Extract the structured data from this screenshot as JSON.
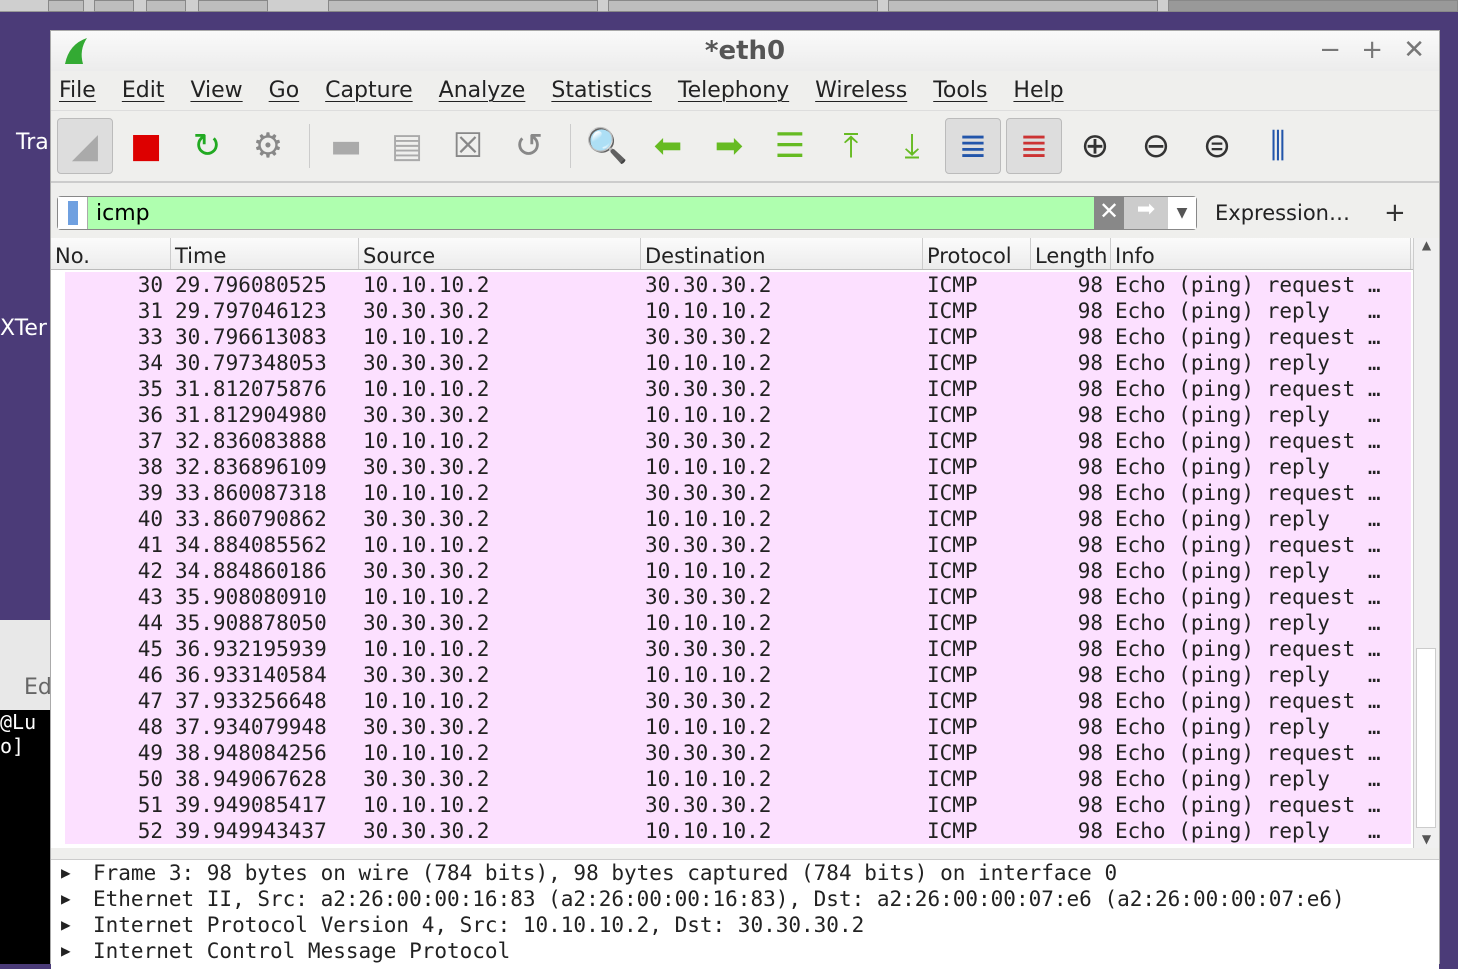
{
  "window": {
    "title": "*eth0",
    "minimize": "−",
    "maximize": "+",
    "close": "✕"
  },
  "desktop": {
    "labels": [
      "Tra",
      "XTer",
      "Ed",
      "@Lu",
      "o]"
    ]
  },
  "menu": [
    "File",
    "Edit",
    "View",
    "Go",
    "Capture",
    "Analyze",
    "Statistics",
    "Telephony",
    "Wireless",
    "Tools",
    "Help"
  ],
  "toolbar": [
    {
      "icon": "shark-fin-start-icon",
      "glyph": "◢",
      "color": "#aaaaaa",
      "on": true
    },
    {
      "icon": "stop-capture-icon",
      "glyph": "■",
      "color": "#dd0000"
    },
    {
      "icon": "restart-capture-icon",
      "glyph": "↻",
      "color": "#22aa22"
    },
    {
      "icon": "capture-options-gear-icon",
      "glyph": "⚙",
      "color": "#888888"
    },
    {
      "sep": true
    },
    {
      "icon": "open-file-icon",
      "glyph": "▬",
      "color": "#aaaaaa"
    },
    {
      "icon": "save-file-icon",
      "glyph": "▤",
      "color": "#aaaaaa"
    },
    {
      "icon": "close-file-icon",
      "glyph": "☒",
      "color": "#888888"
    },
    {
      "icon": "reload-file-icon",
      "glyph": "↺",
      "color": "#888888"
    },
    {
      "sep": true
    },
    {
      "icon": "find-packet-icon",
      "glyph": "🔍",
      "color": "#333333"
    },
    {
      "icon": "go-back-icon",
      "glyph": "⬅",
      "color": "#66bb22"
    },
    {
      "icon": "go-forward-icon",
      "glyph": "➡",
      "color": "#66bb22"
    },
    {
      "icon": "go-to-packet-icon",
      "glyph": "☰",
      "color": "#66bb22"
    },
    {
      "icon": "first-packet-icon",
      "glyph": "⤒",
      "color": "#66bb22"
    },
    {
      "icon": "last-packet-icon",
      "glyph": "⤓",
      "color": "#66bb22"
    },
    {
      "icon": "auto-scroll-icon",
      "glyph": "≣",
      "color": "#2255aa",
      "on": true
    },
    {
      "icon": "colorize-icon",
      "glyph": "≣",
      "color": "#cc3333",
      "on": true
    },
    {
      "icon": "zoom-in-icon",
      "glyph": "⊕",
      "color": "#333333"
    },
    {
      "icon": "zoom-out-icon",
      "glyph": "⊖",
      "color": "#333333"
    },
    {
      "icon": "zoom-reset-icon",
      "glyph": "⊜",
      "color": "#333333"
    },
    {
      "icon": "resize-columns-icon",
      "glyph": "⫼",
      "color": "#2255aa"
    }
  ],
  "filter": {
    "value": "icmp",
    "expression_label": "Expression…",
    "add_label": "+",
    "bg": "#afffaf"
  },
  "columns": [
    "No.",
    "Time",
    "Source",
    "Destination",
    "Protocol",
    "Length",
    "Info"
  ],
  "packets": [
    [
      "30",
      "29.796080525",
      "10.10.10.2",
      "30.30.30.2",
      "ICMP",
      "98",
      "Echo (ping) request …"
    ],
    [
      "31",
      "29.797046123",
      "30.30.30.2",
      "10.10.10.2",
      "ICMP",
      "98",
      "Echo (ping) reply   …"
    ],
    [
      "33",
      "30.796613083",
      "10.10.10.2",
      "30.30.30.2",
      "ICMP",
      "98",
      "Echo (ping) request …"
    ],
    [
      "34",
      "30.797348053",
      "30.30.30.2",
      "10.10.10.2",
      "ICMP",
      "98",
      "Echo (ping) reply   …"
    ],
    [
      "35",
      "31.812075876",
      "10.10.10.2",
      "30.30.30.2",
      "ICMP",
      "98",
      "Echo (ping) request …"
    ],
    [
      "36",
      "31.812904980",
      "30.30.30.2",
      "10.10.10.2",
      "ICMP",
      "98",
      "Echo (ping) reply   …"
    ],
    [
      "37",
      "32.836083888",
      "10.10.10.2",
      "30.30.30.2",
      "ICMP",
      "98",
      "Echo (ping) request …"
    ],
    [
      "38",
      "32.836896109",
      "30.30.30.2",
      "10.10.10.2",
      "ICMP",
      "98",
      "Echo (ping) reply   …"
    ],
    [
      "39",
      "33.860087318",
      "10.10.10.2",
      "30.30.30.2",
      "ICMP",
      "98",
      "Echo (ping) request …"
    ],
    [
      "40",
      "33.860790862",
      "30.30.30.2",
      "10.10.10.2",
      "ICMP",
      "98",
      "Echo (ping) reply   …"
    ],
    [
      "41",
      "34.884085562",
      "10.10.10.2",
      "30.30.30.2",
      "ICMP",
      "98",
      "Echo (ping) request …"
    ],
    [
      "42",
      "34.884860186",
      "30.30.30.2",
      "10.10.10.2",
      "ICMP",
      "98",
      "Echo (ping) reply   …"
    ],
    [
      "43",
      "35.908080910",
      "10.10.10.2",
      "30.30.30.2",
      "ICMP",
      "98",
      "Echo (ping) request …"
    ],
    [
      "44",
      "35.908878050",
      "30.30.30.2",
      "10.10.10.2",
      "ICMP",
      "98",
      "Echo (ping) reply   …"
    ],
    [
      "45",
      "36.932195939",
      "10.10.10.2",
      "30.30.30.2",
      "ICMP",
      "98",
      "Echo (ping) request …"
    ],
    [
      "46",
      "36.933140584",
      "30.30.30.2",
      "10.10.10.2",
      "ICMP",
      "98",
      "Echo (ping) reply   …"
    ],
    [
      "47",
      "37.933256648",
      "10.10.10.2",
      "30.30.30.2",
      "ICMP",
      "98",
      "Echo (ping) request …"
    ],
    [
      "48",
      "37.934079948",
      "30.30.30.2",
      "10.10.10.2",
      "ICMP",
      "98",
      "Echo (ping) reply   …"
    ],
    [
      "49",
      "38.948084256",
      "10.10.10.2",
      "30.30.30.2",
      "ICMP",
      "98",
      "Echo (ping) request …"
    ],
    [
      "50",
      "38.949067628",
      "30.30.30.2",
      "10.10.10.2",
      "ICMP",
      "98",
      "Echo (ping) reply   …"
    ],
    [
      "51",
      "39.949085417",
      "10.10.10.2",
      "30.30.30.2",
      "ICMP",
      "98",
      "Echo (ping) request …"
    ],
    [
      "52",
      "39.949943437",
      "30.30.30.2",
      "10.10.10.2",
      "ICMP",
      "98",
      "Echo (ping) reply   …"
    ]
  ],
  "row_color": "#fce0ff",
  "details": [
    "Frame 3: 98 bytes on wire (784 bits), 98 bytes captured (784 bits) on interface 0",
    "Ethernet II, Src: a2:26:00:00:16:83 (a2:26:00:00:16:83), Dst: a2:26:00:00:07:e6 (a2:26:00:00:07:e6)",
    "Internet Protocol Version 4, Src: 10.10.10.2, Dst: 30.30.30.2",
    "Internet Control Message Protocol"
  ]
}
